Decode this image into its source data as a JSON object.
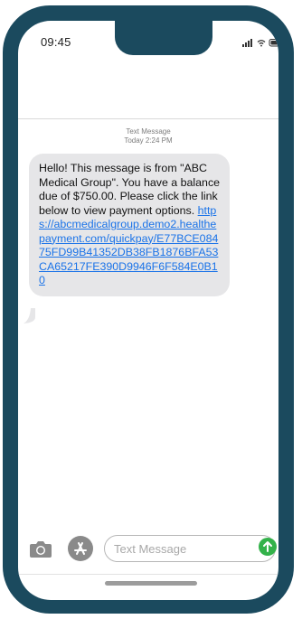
{
  "status_bar": {
    "time": "09:45",
    "icons": [
      "signal-icon",
      "wifi-icon",
      "battery-icon"
    ]
  },
  "thread": {
    "channel_label": "Text Message",
    "timestamp": "Today 2:24 PM"
  },
  "message": {
    "body_text": "Hello! This message is from \"ABC Medical Group\". You have a balance due of $750.00. Please click the link below to view payment options.",
    "link_text": "https://abcmedicalgroup.demo2.healthepayment.com/quickpay/E77BCE08475FD99B41352DB38FB1876BFA53CA65217FE390D9946F6F584E0B10"
  },
  "composer": {
    "placeholder": "Text Message",
    "icons": [
      "camera-icon",
      "app-store-icon",
      "send-arrow-icon"
    ]
  },
  "colors": {
    "phone_frame": "#1b4a5e",
    "bubble_bg": "#e6e6e8",
    "link": "#1a73e8",
    "send_button": "#33b24a"
  }
}
